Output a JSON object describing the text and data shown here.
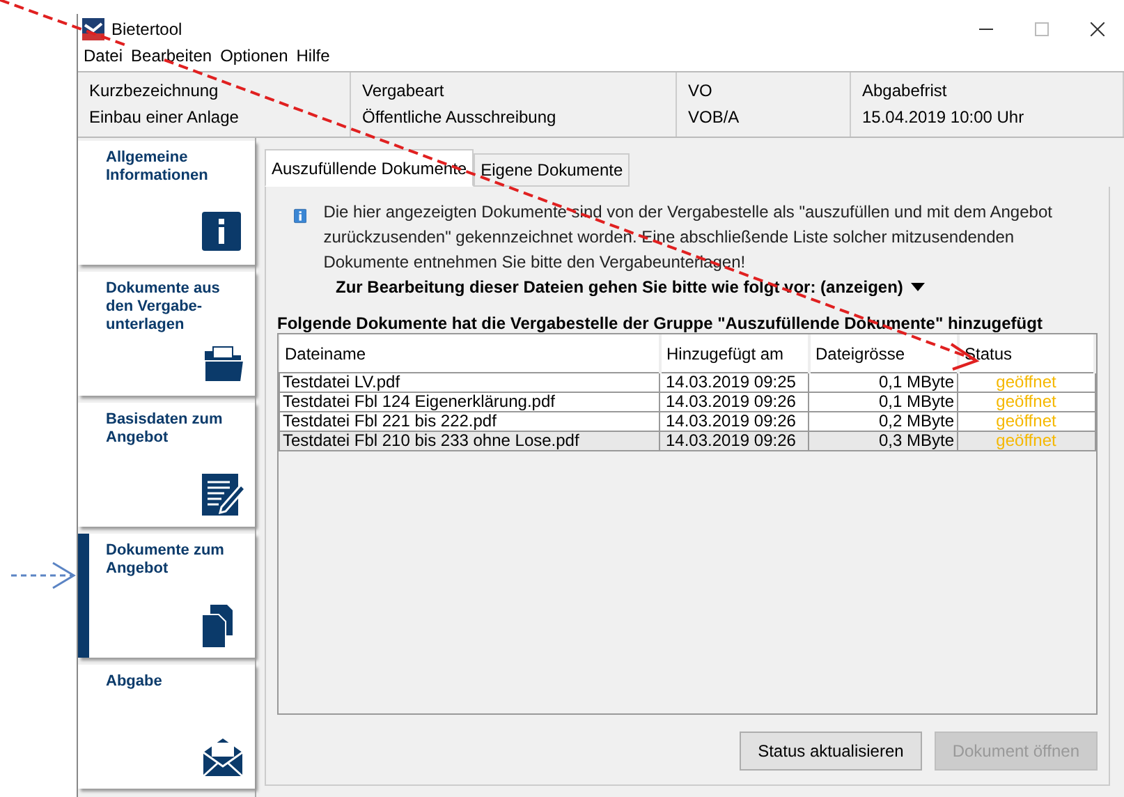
{
  "window": {
    "title": "Bietertool"
  },
  "menu": [
    "Datei",
    "Bearbeiten",
    "Optionen",
    "Hilfe"
  ],
  "header": [
    {
      "label": "Kurzbezeichnung",
      "value": "Einbau einer Anlage"
    },
    {
      "label": "Vergabeart",
      "value": "Öffentliche Ausschreibung"
    },
    {
      "label": "VO",
      "value": "VOB/A"
    },
    {
      "label": "Abgabefrist",
      "value": "15.04.2019 10:00 Uhr"
    }
  ],
  "sidebar": {
    "items": [
      {
        "label": "Allgemeine Informationen",
        "kind": "info",
        "selected": false
      },
      {
        "label": "Dokumente aus den Vergabe-unterlagen",
        "kind": "folder",
        "selected": false
      },
      {
        "label": "Basisdaten zum Angebot",
        "kind": "form",
        "selected": false
      },
      {
        "label": "Dokumente zum Angebot",
        "kind": "documents",
        "selected": true
      },
      {
        "label": "Abgabe",
        "kind": "envelope",
        "selected": false
      }
    ]
  },
  "tabs": [
    {
      "label": "Auszufüllende Dokumente",
      "selected": true
    },
    {
      "label": "Eigene Dokumente",
      "selected": false
    }
  ],
  "info_text": "Die hier angezeigten Dokumente sind von der Vergabestelle als \"auszufüllen und mit dem Angebot zurückzusenden\" gekennzeichnet worden. Eine abschließende Liste solcher mitzusendenden Dokumente entnehmen Sie bitte den Vergabeunterlagen!",
  "instructions_toggle": {
    "label": "Zur Bearbeitung dieser Dateien gehen Sie bitte wie folgt vor: (anzeigen)",
    "expanded": false
  },
  "table": {
    "title": "Folgende Dokumente hat die Vergabestelle der Gruppe \"Auszufüllende Dokumente\" hinzugefügt",
    "columns": [
      "Dateiname",
      "Hinzugefügt am",
      "Dateigrösse",
      "Status"
    ],
    "rows": [
      {
        "cells": [
          "Testdatei LV.pdf",
          "14.03.2019 09:25",
          "0,1 MByte",
          "geöffnet"
        ],
        "selected": false
      },
      {
        "cells": [
          "Testdatei Fbl 124 Eigenerklärung.pdf",
          "14.03.2019 09:26",
          "0,1 MByte",
          "geöffnet"
        ],
        "selected": false
      },
      {
        "cells": [
          "Testdatei Fbl 221 bis 222.pdf",
          "14.03.2019 09:26",
          "0,2 MByte",
          "geöffnet"
        ],
        "selected": false
      },
      {
        "cells": [
          "Testdatei Fbl 210 bis 233 ohne Lose.pdf",
          "14.03.2019 09:26",
          "0,3 MByte",
          "geöffnet"
        ],
        "selected": true
      }
    ]
  },
  "buttons": [
    {
      "label": "Status aktualisieren",
      "disabled": false
    },
    {
      "label": "Dokument öffnen",
      "disabled": true
    }
  ]
}
